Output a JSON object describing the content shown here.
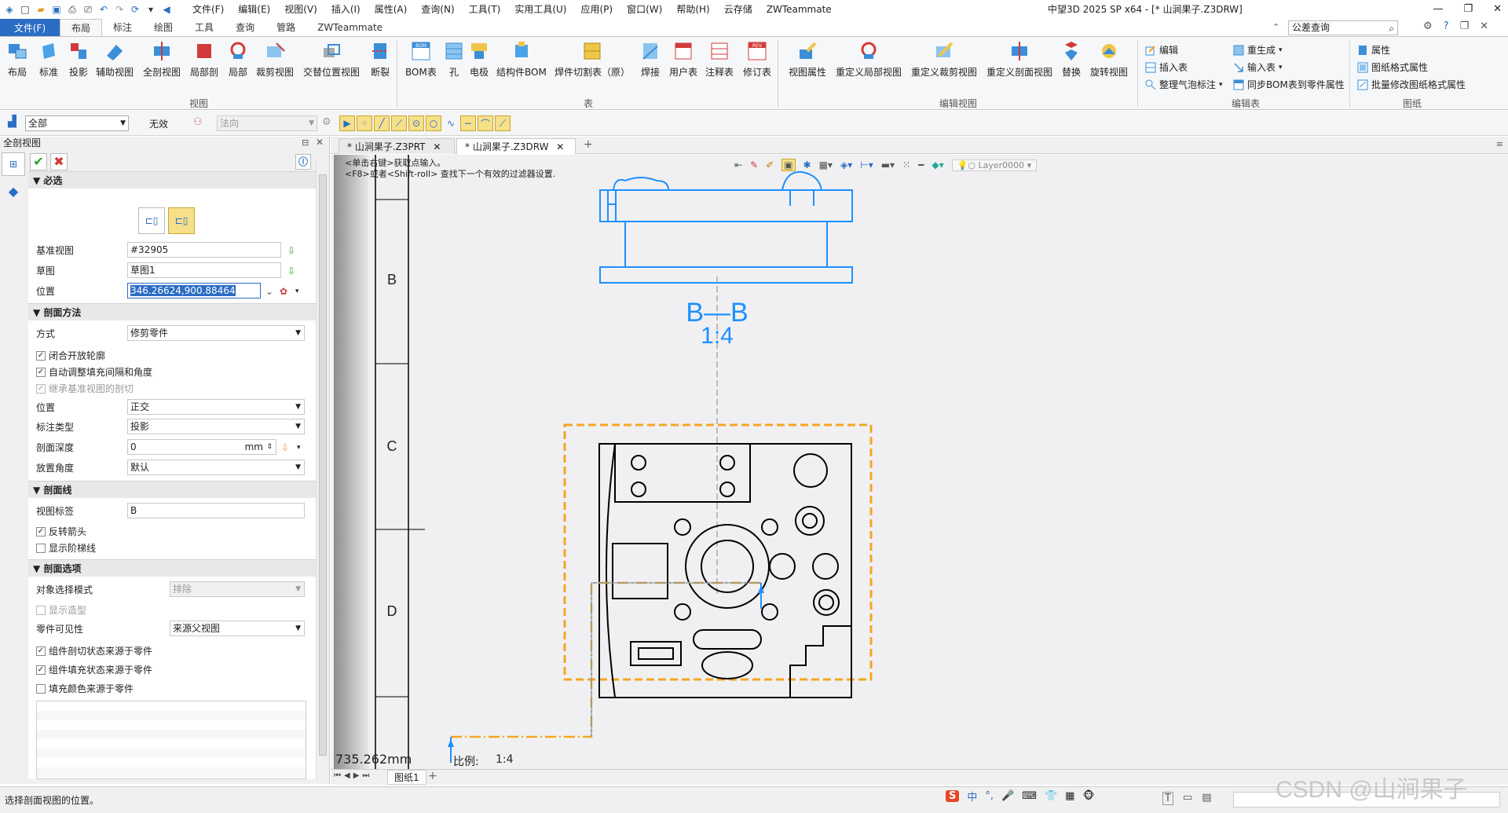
{
  "window_title": "中望3D 2025 SP x64 - [* 山涧果子.Z3DRW]",
  "menu": [
    "文件(F)",
    "编辑(E)",
    "视图(V)",
    "插入(I)",
    "属性(A)",
    "查询(N)",
    "工具(T)",
    "实用工具(U)",
    "应用(P)",
    "窗口(W)",
    "帮助(H)",
    "云存储",
    "ZWTeammate"
  ],
  "ribbon_tabs": {
    "file": "文件(F)",
    "items": [
      "布局",
      "标注",
      "绘图",
      "工具",
      "查询",
      "管路",
      "ZWTeammate"
    ],
    "active": "布局"
  },
  "search": {
    "value": "公差查询"
  },
  "ribbon": {
    "view_group": "视图",
    "view_buttons": [
      "布局",
      "标准",
      "投影",
      "辅助视图",
      "全剖视图",
      "局部剖",
      "局部",
      "裁剪视图",
      "交替位置视图",
      "断裂"
    ],
    "table_group": "表",
    "table_buttons": [
      "BOM表",
      "孔",
      "电极",
      "结构件BOM",
      "焊件切割表（原）",
      "焊接",
      "用户表",
      "注释表",
      "修订表"
    ],
    "edit_view_group": "编辑视图",
    "edit_view_buttons": [
      "视图属性",
      "重定义局部视图",
      "重定义裁剪视图",
      "重定义剖面视图",
      "替换",
      "旋转视图"
    ],
    "edit_table_group": "编辑表",
    "edit_table_small": [
      "编辑",
      "插入表",
      "整理气泡标注",
      "重生成",
      "输入表",
      "同步BOM表到零件属性"
    ],
    "sheet_group": "图纸",
    "sheet_small": [
      "属性",
      "图纸格式属性",
      "批量修改图纸格式属性"
    ],
    "bom_badge": "BOM",
    "rev_badge": "REV"
  },
  "toolbar2": {
    "filter": "全部",
    "invalid": "无效",
    "direction": "法向"
  },
  "panel": {
    "title": "全剖视图",
    "required": "必选",
    "base_view_label": "基准视图",
    "base_view": "#32905",
    "sketch_label": "草图",
    "sketch": "草图1",
    "position_label": "位置",
    "position": "346.26624,900.88464",
    "method_section": "剖面方法",
    "mode_label": "方式",
    "mode": "修剪零件",
    "chk_close": "闭合开放轮廓",
    "chk_auto": "自动调整填充间隔和角度",
    "chk_inherit": "继承基准视图的剖切",
    "pos_label": "位置",
    "pos_value": "正交",
    "dim_type_label": "标注类型",
    "dim_type": "投影",
    "depth_label": "剖面深度",
    "depth": "0",
    "depth_unit": "mm",
    "angle_label": "放置角度",
    "angle": "默认",
    "line_section": "剖面线",
    "view_label_label": "视图标签",
    "view_label": "B",
    "chk_reverse": "反转箭头",
    "chk_step": "显示阶梯线",
    "option_section": "剖面选项",
    "select_mode_label": "对象选择模式",
    "select_mode": "排除",
    "chk_show_model": "显示造型",
    "part_vis_label": "零件可见性",
    "part_vis": "来源父视图",
    "chk_comp_cut": "组件剖切状态来源于零件",
    "chk_comp_fill": "组件填充状态来源于零件",
    "chk_fill_color": "填充颜色来源于零件"
  },
  "doc_tabs": [
    "* 山涧果子.Z3PRT",
    "* 山涧果子.Z3DRW"
  ],
  "hints": [
    "<单击右键>获取点输入。",
    "<F8>或者<Shift-roll> 查找下一个有效的过滤器设置."
  ],
  "layer": "Layer0000",
  "drawing": {
    "zone_labels": [
      "B",
      "C",
      "D"
    ],
    "section_label": "B—B",
    "scale_label": "1:4"
  },
  "readout": {
    "length": "735.262mm",
    "scale_caption": "比例:",
    "scale": "1:4"
  },
  "sheet_tab": "图纸1",
  "status_text": "选择剖面视图的位置。",
  "ime": [
    "中",
    "°,",
    "🎤",
    "⌨",
    "👕",
    "▦",
    "🐵"
  ],
  "watermark": "CSDN @山涧果子",
  "colors": {
    "accent": "#2b6cc4",
    "blue_view": "#1e90ff",
    "orange_frame": "#f5a623",
    "section_line": "#f5a623"
  }
}
